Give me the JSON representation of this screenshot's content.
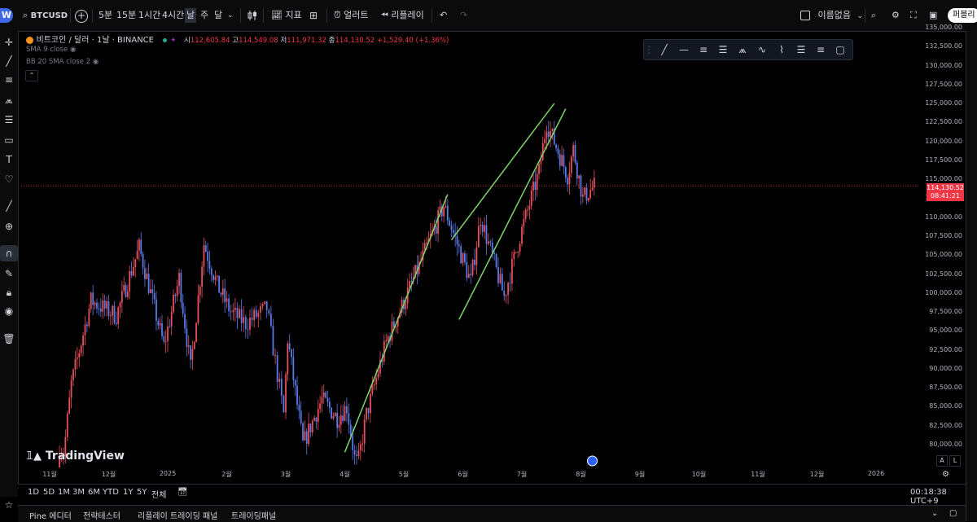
{
  "topbar": {
    "avatar_letter": "W",
    "symbol": "BTCUSD",
    "intervals": [
      "5분",
      "15분",
      "1시간",
      "4시간",
      "날",
      "주",
      "달"
    ],
    "indicators_label": "지표",
    "alert_label": "얼러트",
    "replay_label": "리플레이",
    "layout_name": "이름없음",
    "publish_label": "퍼블리"
  },
  "legend": {
    "title": "비트코인 / 달러 · 1날 · BINANCE",
    "open_label": "시",
    "open_value": "112,605.84",
    "high_label": "고",
    "high_value": "114,549.08",
    "low_label": "저",
    "low_value": "111,971.32",
    "close_label": "종",
    "close_value": "114,130.52",
    "change": "+1,529.40 (+1.36%)",
    "sma_label": "SMA 9 close",
    "bb_label": "BB 20 SMA close 2"
  },
  "watermark": "TradingView",
  "price_axis": {
    "ticks": [
      "135,000.00",
      "132,500.00",
      "130,000.00",
      "127,500.00",
      "125,000.00",
      "122,500.00",
      "120,000.00",
      "117,500.00",
      "115,000.00",
      "112,500.00",
      "110,000.00",
      "107,500.00",
      "105,000.00",
      "102,500.00",
      "100,000.00",
      "97,500.00",
      "95,000.00",
      "92,500.00",
      "90,000.00",
      "87,500.00",
      "85,000.00",
      "82,500.00",
      "80,000.00"
    ],
    "current_price": "114,130.52",
    "countdown": "08:41:21",
    "scale_a": "A",
    "scale_l": "L"
  },
  "time_axis": {
    "ticks": [
      "11월",
      "12월",
      "2025",
      "2월",
      "3월",
      "4월",
      "5월",
      "6월",
      "7월",
      "8월",
      "9월",
      "10월",
      "11월",
      "12월",
      "2026"
    ]
  },
  "range_bar": {
    "ranges": [
      "1D",
      "5D",
      "1M",
      "3M",
      "6M",
      "YTD",
      "1Y",
      "5Y",
      "전체"
    ],
    "clock": "00:18:38 UTC+9"
  },
  "panel_bar": {
    "tabs": [
      "Pine 에디터",
      "전략테스터",
      "리플레이 트레이딩 패널",
      "트레이딩패널"
    ]
  },
  "colors": {
    "background": "#000000",
    "up": "#e8505b",
    "down": "#5b7be8",
    "trendline": "#7fd36a",
    "price_label": "#f23645"
  },
  "chart_data": {
    "type": "candlestick",
    "xlabel": "",
    "ylabel": "",
    "ylim": [
      78000,
      135000
    ],
    "x_range": [
      "2024-11",
      "2026-01"
    ],
    "series": [
      {
        "values": [
          [
            "2024-11-04",
            69000
          ],
          [
            "2024-11-12",
            88000
          ],
          [
            "2024-11-22",
            99000
          ],
          [
            "2024-12-05",
            97000
          ],
          [
            "2024-12-17",
            106000
          ],
          [
            "2024-12-30",
            93000
          ],
          [
            "2025-01-07",
            102000
          ],
          [
            "2025-01-13",
            90000
          ],
          [
            "2025-01-20",
            106500
          ],
          [
            "2025-01-27",
            101000
          ],
          [
            "2025-02-03",
            97500
          ],
          [
            "2025-02-10",
            96000
          ],
          [
            "2025-02-20",
            98000
          ],
          [
            "2025-02-28",
            84000
          ],
          [
            "2025-03-02",
            94000
          ],
          [
            "2025-03-10",
            80000
          ],
          [
            "2025-03-20",
            86000
          ],
          [
            "2025-03-28",
            83500
          ],
          [
            "2025-04-02",
            85000
          ],
          [
            "2025-04-07",
            76500
          ],
          [
            "2025-04-12",
            84000
          ],
          [
            "2025-04-22",
            93500
          ],
          [
            "2025-05-08",
            103000
          ],
          [
            "2025-05-22",
            111500
          ],
          [
            "2025-06-05",
            101500
          ],
          [
            "2025-06-10",
            110000
          ],
          [
            "2025-06-22",
            99500
          ],
          [
            "2025-06-30",
            107500
          ],
          [
            "2025-07-10",
            116000
          ],
          [
            "2025-07-14",
            122500
          ],
          [
            "2025-07-25",
            115500
          ],
          [
            "2025-07-28",
            119000
          ],
          [
            "2025-08-02",
            112500
          ],
          [
            "2025-08-08",
            114130
          ]
        ]
      }
    ],
    "grid": false,
    "last_price": 114130.52
  }
}
